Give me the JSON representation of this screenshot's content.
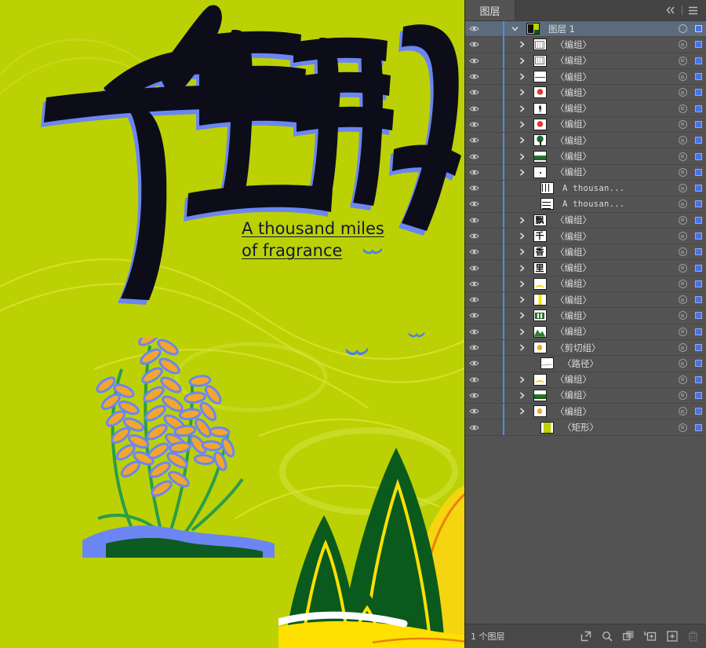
{
  "artwork": {
    "headline_cn": "千里飘香",
    "headline_chars": [
      "千",
      "里",
      "飘",
      "香"
    ],
    "english_line1": "A thousand miles",
    "english_line2": "of fragrance",
    "background_color": "#bcd104",
    "ink_color": "#0d0d1a",
    "shadow_color": "#6b86f2",
    "mountain_color": "#0a5a1e",
    "mountain_outline": "#ffe000",
    "hill_color": "#f5d410",
    "wheat_grain_color": "#f2a62c",
    "wheat_stem_color": "#2a9d4a",
    "swirl_color": "#d7e02a"
  },
  "panel": {
    "tab_label": "图层",
    "collapse_icon": "double-chevron-left-icon",
    "menu_icon": "hamburger-menu-icon",
    "footer_count": "1 个图层",
    "footer_buttons": [
      {
        "name": "locate-object-button",
        "icon": "export-arrow-icon"
      },
      {
        "name": "search-layer-button",
        "icon": "magnifier-icon"
      },
      {
        "name": "make-clipping-mask-button",
        "icon": "overlapping-squares-icon"
      },
      {
        "name": "create-sublayer-button",
        "icon": "new-sublayer-icon"
      },
      {
        "name": "create-new-layer-button",
        "icon": "new-layer-plus-icon"
      },
      {
        "name": "delete-selection-button",
        "icon": "trash-icon"
      }
    ],
    "rows": [
      {
        "label": "图层 1",
        "selected": true,
        "indent": 0,
        "chevron": "down",
        "thumb": "artboard",
        "target": "open",
        "color": "#4a72e8"
      },
      {
        "label": "〈编组〉",
        "selected": false,
        "indent": 1,
        "chevron": "right",
        "thumb": "grid",
        "target": "closed",
        "color": "#4a72e8"
      },
      {
        "label": "〈编组〉",
        "selected": false,
        "indent": 1,
        "chevron": "right",
        "thumb": "grid",
        "target": "closed",
        "color": "#4a72e8"
      },
      {
        "label": "〈编组〉",
        "selected": false,
        "indent": 1,
        "chevron": "right",
        "thumb": "line",
        "target": "closed",
        "color": "#4a72e8"
      },
      {
        "label": "〈编组〉",
        "selected": false,
        "indent": 1,
        "chevron": "right",
        "thumb": "red",
        "target": "closed",
        "color": "#4a72e8"
      },
      {
        "label": "〈编组〉",
        "selected": false,
        "indent": 1,
        "chevron": "right",
        "thumb": "figure",
        "target": "closed",
        "color": "#4a72e8"
      },
      {
        "label": "〈编组〉",
        "selected": false,
        "indent": 1,
        "chevron": "right",
        "thumb": "red",
        "target": "closed",
        "color": "#4a72e8"
      },
      {
        "label": "〈编组〉",
        "selected": false,
        "indent": 1,
        "chevron": "right",
        "thumb": "tree",
        "target": "closed",
        "color": "#4a72e8"
      },
      {
        "label": "〈编组〉",
        "selected": false,
        "indent": 1,
        "chevron": "right",
        "thumb": "land",
        "target": "closed",
        "color": "#4a72e8"
      },
      {
        "label": "〈编组〉",
        "selected": false,
        "indent": 1,
        "chevron": "right",
        "thumb": "dot",
        "target": "closed",
        "color": "#4a72e8"
      },
      {
        "label": "A thousan...",
        "selected": false,
        "indent": 2,
        "chevron": "none",
        "thumb": "text-v",
        "target": "closed",
        "color": "#4a72e8",
        "mono": true
      },
      {
        "label": "A thousan...",
        "selected": false,
        "indent": 2,
        "chevron": "none",
        "thumb": "text-h",
        "target": "closed",
        "color": "#4a72e8",
        "mono": true
      },
      {
        "label": "〈编组〉",
        "selected": false,
        "indent": 1,
        "chevron": "right",
        "thumb": "cn-piao",
        "target": "closed",
        "color": "#4a72e8"
      },
      {
        "label": "〈编组〉",
        "selected": false,
        "indent": 1,
        "chevron": "right",
        "thumb": "cn-qian",
        "target": "closed",
        "color": "#4a72e8"
      },
      {
        "label": "〈编组〉",
        "selected": false,
        "indent": 1,
        "chevron": "right",
        "thumb": "cn-xiang",
        "target": "closed",
        "color": "#4a72e8"
      },
      {
        "label": "〈编组〉",
        "selected": false,
        "indent": 1,
        "chevron": "right",
        "thumb": "cn-li",
        "target": "closed",
        "color": "#4a72e8"
      },
      {
        "label": "〈编组〉",
        "selected": false,
        "indent": 1,
        "chevron": "right",
        "thumb": "curve",
        "target": "closed",
        "color": "#4a72e8"
      },
      {
        "label": "〈编组〉",
        "selected": false,
        "indent": 1,
        "chevron": "right",
        "thumb": "yellowbar",
        "target": "closed",
        "color": "#4a72e8"
      },
      {
        "label": "〈编组〉",
        "selected": false,
        "indent": 1,
        "chevron": "right",
        "thumb": "greenbox",
        "target": "closed",
        "color": "#4a72e8"
      },
      {
        "label": "〈编组〉",
        "selected": false,
        "indent": 1,
        "chevron": "right",
        "thumb": "hill",
        "target": "closed",
        "color": "#4a72e8"
      },
      {
        "label": "〈剪切组〉",
        "selected": false,
        "indent": 1,
        "chevron": "right",
        "thumb": "wheat",
        "target": "closed",
        "color": "#4a72e8"
      },
      {
        "label": "〈路径〉",
        "selected": false,
        "indent": 2,
        "chevron": "none",
        "thumb": "thin",
        "target": "closed",
        "color": "#4a72e8"
      },
      {
        "label": "〈编组〉",
        "selected": false,
        "indent": 1,
        "chevron": "right",
        "thumb": "curve",
        "target": "closed",
        "color": "#4a72e8"
      },
      {
        "label": "〈编组〉",
        "selected": false,
        "indent": 1,
        "chevron": "right",
        "thumb": "land",
        "target": "closed",
        "color": "#4a72e8"
      },
      {
        "label": "〈编组〉",
        "selected": false,
        "indent": 1,
        "chevron": "right",
        "thumb": "wheat",
        "target": "closed",
        "color": "#4a72e8"
      },
      {
        "label": "〈矩形〉",
        "selected": false,
        "indent": 2,
        "chevron": "none",
        "thumb": "rect",
        "target": "closed",
        "color": "#4a72e8"
      }
    ]
  }
}
